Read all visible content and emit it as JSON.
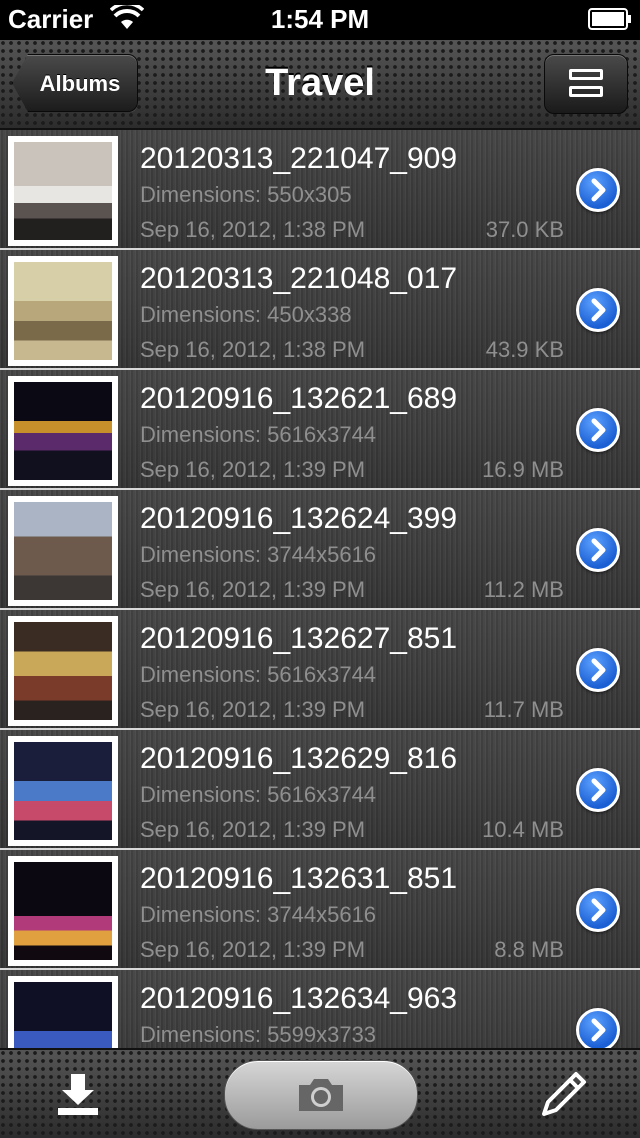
{
  "status_bar": {
    "carrier": "Carrier",
    "time": "1:54 PM",
    "icons": [
      "wifi-icon",
      "battery-icon"
    ]
  },
  "nav_bar": {
    "back_label": "Albums",
    "title": "Travel",
    "layout_button_icon": "list-layout-icon"
  },
  "photos": [
    {
      "filename": "20120313_221047_909",
      "dimensions": "Dimensions: 550x305",
      "date": "Sep 16, 2012, 1:38 PM",
      "size": "37.0 KB"
    },
    {
      "filename": "20120313_221048_017",
      "dimensions": "Dimensions: 450x338",
      "date": "Sep 16, 2012, 1:38 PM",
      "size": "43.9 KB"
    },
    {
      "filename": "20120916_132621_689",
      "dimensions": "Dimensions: 5616x3744",
      "date": "Sep 16, 2012, 1:39 PM",
      "size": "16.9 MB"
    },
    {
      "filename": "20120916_132624_399",
      "dimensions": "Dimensions: 3744x5616",
      "date": "Sep 16, 2012, 1:39 PM",
      "size": "11.2 MB"
    },
    {
      "filename": "20120916_132627_851",
      "dimensions": "Dimensions: 5616x3744",
      "date": "Sep 16, 2012, 1:39 PM",
      "size": "11.7 MB"
    },
    {
      "filename": "20120916_132629_816",
      "dimensions": "Dimensions: 5616x3744",
      "date": "Sep 16, 2012, 1:39 PM",
      "size": "10.4 MB"
    },
    {
      "filename": "20120916_132631_851",
      "dimensions": "Dimensions: 3744x5616",
      "date": "Sep 16, 2012, 1:39 PM",
      "size": "8.8 MB"
    },
    {
      "filename": "20120916_132634_963",
      "dimensions": "Dimensions: 5599x3733",
      "date": "",
      "size": ""
    }
  ],
  "toolbar": {
    "download_icon": "download-icon",
    "camera_icon": "camera-icon",
    "edit_icon": "pencil-icon"
  },
  "colors": {
    "accent_blue": "#1b5fd4",
    "secondary_text": "#8f8f8f"
  }
}
